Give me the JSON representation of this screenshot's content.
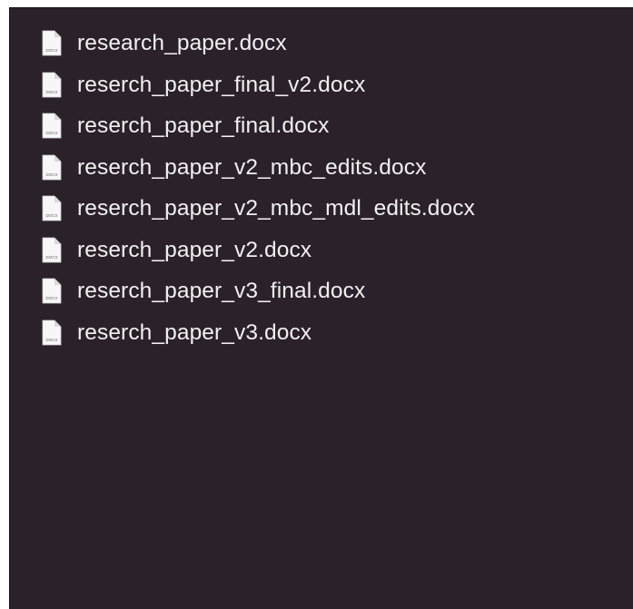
{
  "file_list": {
    "icon_type": "docx-document-icon",
    "icon_label": "DOCX",
    "files": [
      {
        "name": "research_paper.docx"
      },
      {
        "name": "reserch_paper_final_v2.docx"
      },
      {
        "name": "reserch_paper_final.docx"
      },
      {
        "name": "reserch_paper_v2_mbc_edits.docx"
      },
      {
        "name": "reserch_paper_v2_mbc_mdl_edits.docx"
      },
      {
        "name": "reserch_paper_v2.docx"
      },
      {
        "name": "reserch_paper_v3_final.docx"
      },
      {
        "name": "reserch_paper_v3.docx"
      }
    ]
  },
  "colors": {
    "background": "#2b212a",
    "text": "#f2eff2",
    "icon_page": "#f7f7f7",
    "icon_fold": "#d8d8d8"
  }
}
